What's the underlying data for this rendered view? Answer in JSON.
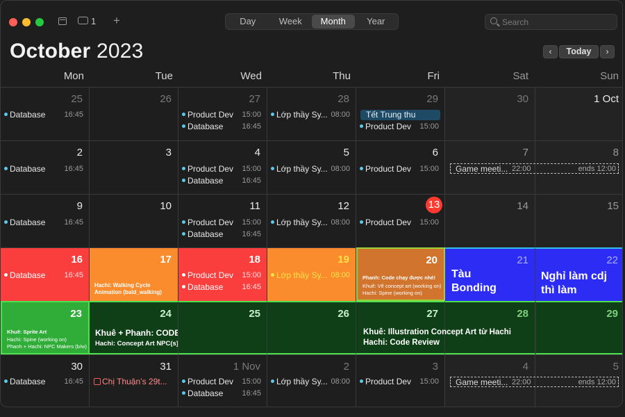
{
  "toolbar": {
    "inbox_count": "1",
    "views": [
      "Day",
      "Week",
      "Month",
      "Year"
    ],
    "active_view": "Month",
    "search_placeholder": "Search"
  },
  "header": {
    "month": "October",
    "year": "2023",
    "today_label": "Today",
    "prev_label": "<",
    "next_label": ">"
  },
  "weekdays": [
    "Mon",
    "Tue",
    "Wed",
    "Thu",
    "Fri",
    "Sat",
    "Sun"
  ],
  "colors": {
    "red": "#fa3d3d",
    "orange": "#fa8c2d",
    "dark_orange": "#d0742e",
    "blue": "#2c2cf5",
    "green": "#2fad38",
    "dark_green": "#0f3f17",
    "event_dot": "#5ec8e8",
    "today": "#ff3b30"
  },
  "weeks": [
    {
      "days": [
        "25",
        "26",
        "27",
        "28",
        "29",
        "30",
        "1 Oct"
      ],
      "events": {
        "mon": [
          {
            "name": "Database",
            "time": "16:45"
          }
        ],
        "wed": [
          {
            "name": "Product Dev",
            "time": "15:00"
          },
          {
            "name": "Database",
            "time": "16:45"
          }
        ],
        "thu": [
          {
            "name": "Lớp thầy Sy...",
            "time": "08:00"
          }
        ],
        "fri_allday": "Tết Trung thu",
        "fri": [
          {
            "name": "Product Dev",
            "time": "15:00"
          }
        ]
      }
    },
    {
      "days": [
        "2",
        "3",
        "4",
        "5",
        "6",
        "7",
        "8"
      ],
      "events": {
        "mon": [
          {
            "name": "Database",
            "time": "16:45"
          }
        ],
        "wed": [
          {
            "name": "Product Dev",
            "time": "15:00"
          },
          {
            "name": "Database",
            "time": "16:45"
          }
        ],
        "thu": [
          {
            "name": "Lớp thầy Sy...",
            "time": "08:00"
          }
        ],
        "fri": [
          {
            "name": "Product Dev",
            "time": "15:00"
          }
        ],
        "weekend_span": {
          "name": "Game meeti...",
          "time": "22:00",
          "ends": "ends 12:00"
        }
      }
    },
    {
      "days": [
        "9",
        "10",
        "11",
        "12",
        "13",
        "14",
        "15"
      ],
      "events": {
        "mon": [
          {
            "name": "Database",
            "time": "16:45"
          }
        ],
        "wed": [
          {
            "name": "Product Dev",
            "time": "15:00"
          },
          {
            "name": "Database",
            "time": "16:45"
          }
        ],
        "thu": [
          {
            "name": "Lớp thầy Sy...",
            "time": "08:00"
          }
        ],
        "fri": [
          {
            "name": "Product Dev",
            "time": "15:00"
          }
        ]
      }
    },
    {
      "days": [
        "16",
        "17",
        "18",
        "19",
        "20",
        "21",
        "22"
      ],
      "events": {
        "mon": [
          {
            "name": "Database",
            "time": "16:45"
          }
        ],
        "tue_note": [
          "Hachi: Walking Cycle",
          "Animation (bald_walking)"
        ],
        "wed": [
          {
            "name": "Product Dev",
            "time": "15:00"
          },
          {
            "name": "Database",
            "time": "16:45"
          }
        ],
        "thu": [
          {
            "name": "Lớp thầy Sy...",
            "time": "08:00"
          }
        ],
        "fri_notes": [
          "Phanh: Code chạy được nhé!",
          "Khuê: Vẽ concept art (working on)",
          "Hachi: Spine (working on)"
        ],
        "sat_big": [
          "Tàu",
          "Bonding"
        ],
        "sun_big": [
          "Nghỉ làm cdj",
          "thì làm"
        ]
      }
    },
    {
      "days": [
        "23",
        "24",
        "25",
        "26",
        "27",
        "28",
        "29"
      ],
      "events": {
        "mon_notes": [
          "Khuê: Sprite Art",
          "Hachi: Spine (working on)",
          "Phanh + Hachi: NPC Makers (b/w)"
        ],
        "tue_big": "Khuê + Phanh: CODE",
        "tue_sub": "Hachi: Concept Art NPC(s)",
        "fri_big": "Khuê: Illustration Concept Art từ Hachi",
        "fri_sub": "Hachi: Code Review"
      }
    },
    {
      "days": [
        "30",
        "31",
        "1 Nov",
        "2",
        "3",
        "4",
        "5"
      ],
      "events": {
        "mon": [
          {
            "name": "Database",
            "time": "16:45"
          }
        ],
        "tue_birthday": "Chị Thuận’s 29t...",
        "wed": [
          {
            "name": "Product Dev",
            "time": "15:00"
          },
          {
            "name": "Database",
            "time": "16:45"
          }
        ],
        "thu": [
          {
            "name": "Lớp thầy Sy...",
            "time": "08:00"
          }
        ],
        "fri": [
          {
            "name": "Product Dev",
            "time": "15:00"
          }
        ],
        "weekend_span": {
          "name": "Game meeti...",
          "time": "22:00",
          "ends": "ends 12:00"
        }
      }
    }
  ]
}
